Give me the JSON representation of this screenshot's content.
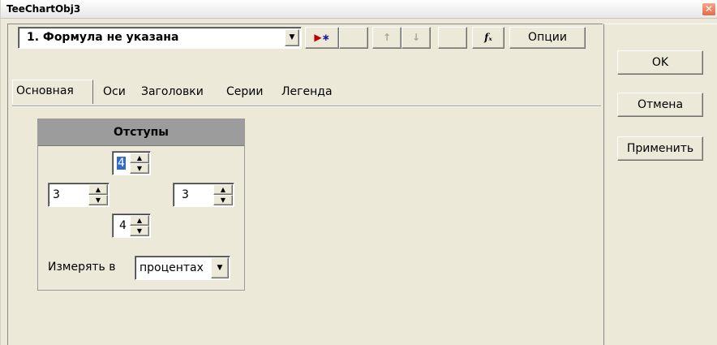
{
  "window": {
    "title": "TeeChartObj3",
    "close_glyph": "✕"
  },
  "toolbar": {
    "series_combo_value": "1.  Формула не указана",
    "add_icon": "▸∗",
    "up_icon": "↑",
    "down_icon": "↓",
    "function_icon": "fₓ",
    "options_label": "Опции",
    "accent_color": "#c00000",
    "add_star_color": "#1a1aa6"
  },
  "tabs": [
    {
      "label": "Основная",
      "active": true
    },
    {
      "label": "Оси",
      "active": false
    },
    {
      "label": "Заголовки",
      "active": false
    },
    {
      "label": "Серии",
      "active": false
    },
    {
      "label": "Легенда",
      "active": false
    }
  ],
  "margins": {
    "title": "Отступы",
    "top": "4",
    "left": "3",
    "right": "3",
    "bottom": "4",
    "measure_label": "Измерять в",
    "measure_value": "процентах"
  },
  "dialog_buttons": {
    "ok": "OK",
    "cancel": "Отмена",
    "apply": "Применить"
  }
}
